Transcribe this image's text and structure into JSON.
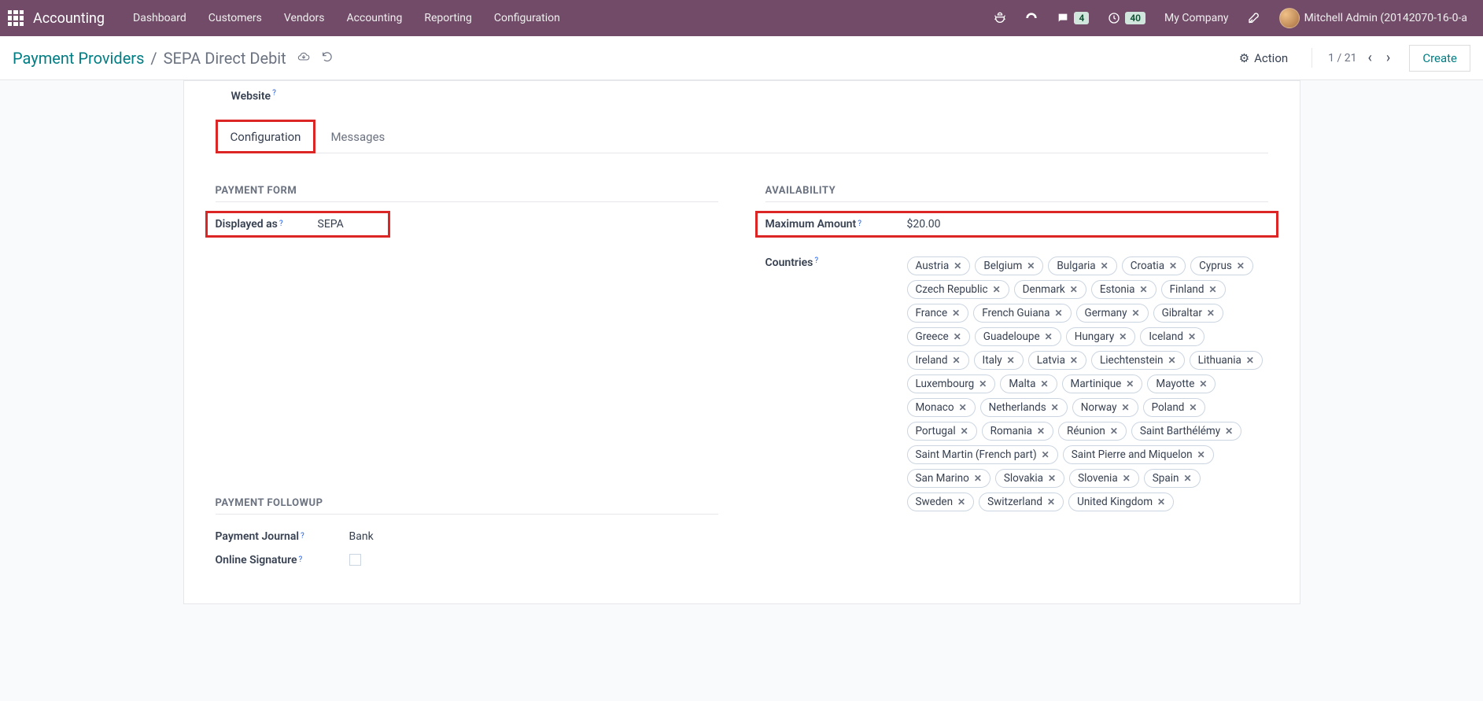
{
  "topnav": {
    "brand": "Accounting",
    "menu": [
      "Dashboard",
      "Customers",
      "Vendors",
      "Accounting",
      "Reporting",
      "Configuration"
    ],
    "chat_badge": "4",
    "clock_badge": "40",
    "company": "My Company",
    "user": "Mitchell Admin (20142070-16-0-a"
  },
  "controlbar": {
    "crumb_parent": "Payment Providers",
    "crumb_current": "SEPA Direct Debit",
    "action_label": "Action",
    "pager": "1 / 21",
    "create_label": "Create"
  },
  "website_label": "Website",
  "tabs": {
    "config": "Configuration",
    "messages": "Messages"
  },
  "left": {
    "section_payment_form": "PAYMENT FORM",
    "displayed_as_label": "Displayed as",
    "displayed_as_value": "SEPA",
    "section_followup": "PAYMENT FOLLOWUP",
    "payment_journal_label": "Payment Journal",
    "payment_journal_value": "Bank",
    "online_signature_label": "Online Signature"
  },
  "right": {
    "section_availability": "AVAILABILITY",
    "max_amount_label": "Maximum Amount",
    "max_amount_value": "$20.00",
    "countries_label": "Countries",
    "countries": [
      "Austria",
      "Belgium",
      "Bulgaria",
      "Croatia",
      "Cyprus",
      "Czech Republic",
      "Denmark",
      "Estonia",
      "Finland",
      "France",
      "French Guiana",
      "Germany",
      "Gibraltar",
      "Greece",
      "Guadeloupe",
      "Hungary",
      "Iceland",
      "Ireland",
      "Italy",
      "Latvia",
      "Liechtenstein",
      "Lithuania",
      "Luxembourg",
      "Malta",
      "Martinique",
      "Mayotte",
      "Monaco",
      "Netherlands",
      "Norway",
      "Poland",
      "Portugal",
      "Romania",
      "Réunion",
      "Saint Barthélémy",
      "Saint Martin (French part)",
      "Saint Pierre and Miquelon",
      "San Marino",
      "Slovakia",
      "Slovenia",
      "Spain",
      "Sweden",
      "Switzerland",
      "United Kingdom"
    ]
  }
}
